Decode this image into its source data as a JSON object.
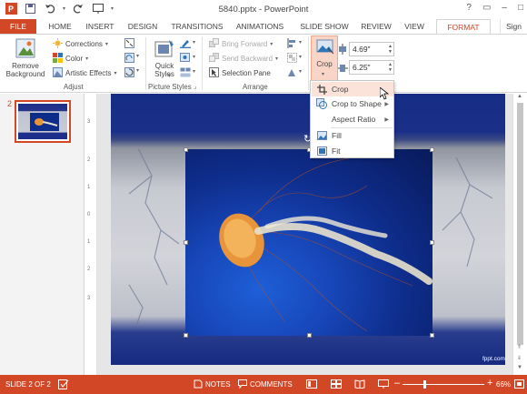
{
  "window": {
    "title": "5840.pptx - PowerPoint",
    "controls": [
      "?",
      "–",
      "□",
      "✕"
    ]
  },
  "qat": {
    "icons": [
      "save-icon",
      "undo-icon",
      "redo-icon",
      "start-slideshow-icon",
      "customize-icon"
    ]
  },
  "tabs": [
    {
      "label": "FILE"
    },
    {
      "label": "HOME"
    },
    {
      "label": "INSERT"
    },
    {
      "label": "DESIGN"
    },
    {
      "label": "TRANSITIONS"
    },
    {
      "label": "ANIMATIONS"
    },
    {
      "label": "SLIDE SHOW"
    },
    {
      "label": "REVIEW"
    },
    {
      "label": "VIEW"
    },
    {
      "label": "FORMAT"
    }
  ],
  "signin": "Sign",
  "ribbon": {
    "adjust": {
      "label": "Adjust",
      "remove_background": "Remove Background",
      "corrections": "Corrections",
      "color": "Color",
      "artistic_effects": "Artistic Effects"
    },
    "picture_styles": {
      "label": "Picture Styles",
      "quick_styles": "Quick Styles"
    },
    "arrange": {
      "label": "Arrange",
      "bring_forward": "Bring Forward",
      "send_backward": "Send Backward",
      "selection_pane": "Selection Pane"
    },
    "size": {
      "crop": "Crop",
      "height": "4.69\"",
      "width": "6.25\""
    }
  },
  "crop_menu": {
    "items": [
      {
        "label": "Crop",
        "submenu": false
      },
      {
        "label": "Crop to Shape",
        "submenu": true
      },
      {
        "label": "Aspect Ratio",
        "submenu": true
      },
      {
        "label": "Fill",
        "submenu": false
      },
      {
        "label": "Fit",
        "submenu": false
      }
    ]
  },
  "slides_pane": {
    "selected_number": "2"
  },
  "ruler": {
    "numbers": [
      "3",
      "2",
      "1",
      "0",
      "1",
      "2",
      "3"
    ]
  },
  "slide": {
    "watermark": "fppt.com"
  },
  "status": {
    "slide_info": "SLIDE 2 OF 2",
    "notes": "NOTES",
    "comments": "COMMENTS",
    "zoom": "66%",
    "minus": "–",
    "plus": "+"
  },
  "colors": {
    "accent": "#d24726",
    "highlight": "#fbe3d9",
    "slide_blue": "#162d85"
  }
}
